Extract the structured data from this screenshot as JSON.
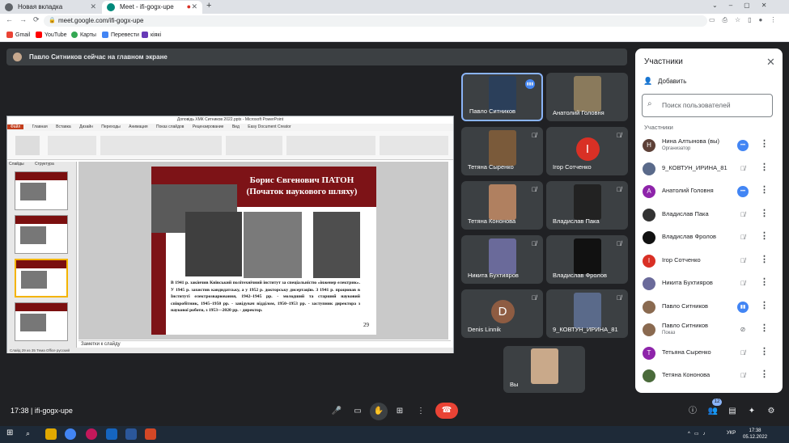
{
  "browser": {
    "tabs": [
      {
        "label": "Новая вкладка"
      },
      {
        "label": "Meet - ifi-gogx-upe"
      }
    ],
    "new_tab": "+",
    "address": "meet.google.com/ifi-gogx-upe",
    "bookmarks": [
      "Gmail",
      "YouTube",
      "Карты",
      "Перевести",
      "кіякі"
    ]
  },
  "notice": "Павло Ситников сейчас на главном экране",
  "presentation": {
    "window_title": "Доповідь ХМК Ситников 2022.pptx - Microsoft PowerPoint",
    "ribbon_tabs": [
      "Файл",
      "Главная",
      "Вставка",
      "Дизайн",
      "Переходы",
      "Анимация",
      "Показ слайдов",
      "Рецензирование",
      "Вид",
      "Easy Document Creator"
    ],
    "slide_title": "Борис Євгенович ПАТОН (Початок наукового шляху)",
    "slide_text": "В 1941 р. закінчив Київський політехнічний інститут за спеціальністю «інженер електрик». У 1945 р. захистив кандидатську, а у 1952 р. докторську дисертацію. З 1941 р. працював в Інституті електрозварювання, 1942–1945 рр. - молодший та старший науковий співробітник, 1945–1950 рр. - завідувач відділом, 1950–1953 рр. - заступник директора з наукової роботи, з 1953—2020 рр. - директор.",
    "slide_number": "29",
    "notes_placeholder": "Заметки к слайду",
    "status": "Слайд 29 из 35   Тема Office   русский",
    "panel_tabs": [
      "Слайды",
      "Структура"
    ]
  },
  "tiles": [
    {
      "name": "Павло Ситников",
      "type": "photo",
      "color": "#2b3f5a",
      "active": true,
      "mic": "speaking"
    },
    {
      "name": "Анатолий Головня",
      "type": "photo",
      "color": "#8a7a5c",
      "mic": ""
    },
    {
      "name": "Тетяна Сыренко",
      "type": "photo",
      "color": "#7a5a3a",
      "mic": "muted"
    },
    {
      "name": "Ігор Сотченко",
      "type": "letter",
      "letter": "І",
      "color": "#d93025",
      "mic": "muted"
    },
    {
      "name": "Тетяна Кононова",
      "type": "photo",
      "color": "#b08060",
      "mic": "muted"
    },
    {
      "name": "Владислав Пака",
      "type": "photo",
      "color": "#222222",
      "mic": "muted"
    },
    {
      "name": "Никита Бухтияров",
      "type": "photo",
      "color": "#6a6a9a",
      "mic": "muted"
    },
    {
      "name": "Владислав Фролов",
      "type": "photo",
      "color": "#111111",
      "mic": "muted"
    },
    {
      "name": "Denis Linnik",
      "type": "letter",
      "letter": "D",
      "color": "#8e5c42",
      "mic": "muted"
    },
    {
      "name": "9_КОВТУН_ИРИНА_81",
      "type": "photo",
      "color": "#5a6a8a",
      "mic": "muted"
    },
    {
      "name": "Вы",
      "type": "photo",
      "color": "#c9a98a",
      "mic": ""
    }
  ],
  "participants_panel": {
    "title": "Участники",
    "add_label": "Добавить",
    "search_placeholder": "Поиск пользователей",
    "section": "Участники",
    "people": [
      {
        "name": "Нина Алтынова (вы)",
        "sub": "Организатор",
        "avatar": "Н",
        "color": "#5d4037",
        "mic": "on-dots"
      },
      {
        "name": "9_КОВТУН_ИРИНА_81",
        "sub": "",
        "avatar": "",
        "color": "#5a6a8a",
        "mic": "muted"
      },
      {
        "name": "Анатолий Головня",
        "sub": "",
        "avatar": "А",
        "color": "#8e24aa",
        "mic": "on-dots"
      },
      {
        "name": "Владислав Пака",
        "sub": "",
        "avatar": "",
        "color": "#333333",
        "mic": "muted"
      },
      {
        "name": "Владислав Фролов",
        "sub": "",
        "avatar": "",
        "color": "#111111",
        "mic": "muted"
      },
      {
        "name": "Ігор Сотченко",
        "sub": "",
        "avatar": "І",
        "color": "#d93025",
        "mic": "muted"
      },
      {
        "name": "Никита Бухтияров",
        "sub": "",
        "avatar": "",
        "color": "#6a6a9a",
        "mic": "muted"
      },
      {
        "name": "Павло Ситников",
        "sub": "",
        "avatar": "",
        "color": "#8a6a50",
        "mic": "speaking"
      },
      {
        "name": "Павло Ситников",
        "sub": "Показ",
        "avatar": "",
        "color": "#8a6a50",
        "mic": "present"
      },
      {
        "name": "Тетьяна Сыренко",
        "sub": "",
        "avatar": "Т",
        "color": "#8e24aa",
        "mic": "muted"
      },
      {
        "name": "Тетяна Кононова",
        "sub": "",
        "avatar": "",
        "color": "#4a6a3a",
        "mic": "muted"
      }
    ]
  },
  "bottom": {
    "meeting_info": "17:38  |  ifi-gogx-upe",
    "people_count": "12"
  },
  "taskbar": {
    "lang": "УКР",
    "time": "17:38",
    "date": "05.12.2022"
  }
}
